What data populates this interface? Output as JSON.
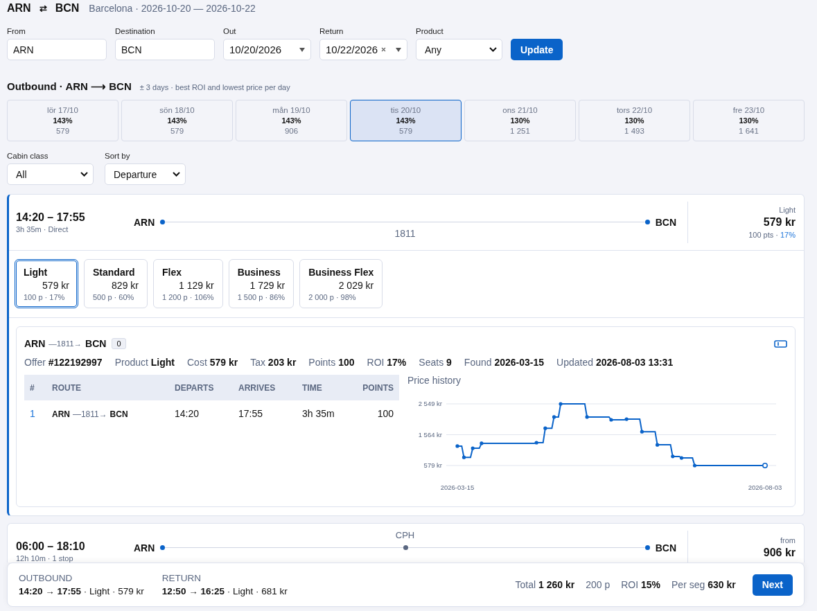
{
  "header": {
    "origin": "ARN",
    "swap": "⇄",
    "destination": "BCN",
    "subtitle": "Barcelona · 2026-10-20 — 2026-10-22"
  },
  "search": {
    "fields": [
      {
        "label": "From",
        "kind": "text",
        "value": "ARN"
      },
      {
        "label": "Destination",
        "kind": "text",
        "value": "BCN"
      },
      {
        "label": "Out",
        "kind": "date",
        "value": "10/20/2026"
      },
      {
        "label": "Return",
        "kind": "date",
        "value": "10/22/2026",
        "clearable": true
      },
      {
        "label": "Product",
        "kind": "select",
        "value": "Any"
      }
    ],
    "button": "Update"
  },
  "outbound": {
    "title": "Outbound · ARN ⟶ BCN",
    "note": "± 3 days · best ROI and lowest price per day",
    "days": [
      {
        "label": "lör 17/10",
        "roi": "143%",
        "price": "579",
        "selected": false
      },
      {
        "label": "sön 18/10",
        "roi": "143%",
        "price": "579",
        "selected": false
      },
      {
        "label": "mån 19/10",
        "roi": "143%",
        "price": "906",
        "selected": false
      },
      {
        "label": "tis 20/10",
        "roi": "143%",
        "price": "579",
        "selected": true
      },
      {
        "label": "ons 21/10",
        "roi": "130%",
        "price": "1 251",
        "selected": false
      },
      {
        "label": "tors 22/10",
        "roi": "130%",
        "price": "1 493",
        "selected": false
      },
      {
        "label": "fre 23/10",
        "roi": "130%",
        "price": "1 641",
        "selected": false
      }
    ]
  },
  "filters": [
    {
      "label": "Cabin class",
      "value": "All"
    },
    {
      "label": "Sort by",
      "value": "Departure"
    }
  ],
  "flights": [
    {
      "times": "14:20 – 17:55",
      "summary": "3h 35m · Direct",
      "from": "ARN",
      "to": "BCN",
      "segments": [
        "1811"
      ],
      "fare_label": "Light",
      "price": "579 kr",
      "points": "100 pts ·",
      "roi": "17%",
      "expanded": true,
      "fares": [
        {
          "name": "Light",
          "price": "579 kr",
          "meta": "100 p · 17%",
          "selected": true
        },
        {
          "name": "Standard",
          "price": "829 kr",
          "meta": "500 p · 60%",
          "selected": false
        },
        {
          "name": "Flex",
          "price": "1 129 kr",
          "meta": "1 200 p · 106%",
          "selected": false
        },
        {
          "name": "Business",
          "price": "1 729 kr",
          "meta": "1 500 p · 86%",
          "selected": false
        },
        {
          "name": "Business Flex",
          "price": "2 029 kr",
          "meta": "2 000 p · 98%",
          "selected": false
        }
      ],
      "detail": {
        "from": "ARN",
        "flight": "—1811→",
        "to": "BCN",
        "badge": "0",
        "meta": [
          {
            "label": "Offer",
            "value": "#122192997"
          },
          {
            "label": "Product",
            "value": "Light"
          },
          {
            "label": "Cost",
            "value": "579 kr"
          },
          {
            "label": "Tax",
            "value": "203 kr"
          },
          {
            "label": "Points",
            "value": "100"
          },
          {
            "label": "ROI",
            "value": "17%"
          },
          {
            "label": "Seats",
            "value": "9"
          },
          {
            "label": "Found",
            "value": "2026-03-15"
          },
          {
            "label": "Updated",
            "value": "2026-08-03 13:31"
          }
        ],
        "table": {
          "columns": [
            "#",
            "ROUTE",
            "DEPARTS",
            "ARRIVES",
            "TIME",
            "POINTS"
          ],
          "rows": [
            {
              "index": "1",
              "from": "ARN",
              "flight": "—1811→",
              "to": "BCN",
              "departs": "14:20",
              "arrives": "17:55",
              "time": "3h 35m",
              "points": "100"
            }
          ]
        },
        "price_history": {
          "title": "Price history",
          "chart_data": {
            "type": "line",
            "categories": [
              "2026-03-15",
              null,
              null,
              null,
              null,
              null,
              null,
              null,
              null,
              null,
              null,
              null,
              null,
              null,
              null,
              null,
              null,
              null,
              null,
              null,
              null,
              null,
              null,
              null,
              null,
              null,
              null,
              null,
              null,
              null,
              null,
              null,
              null,
              null,
              null,
              null,
              null,
              null,
              null,
              null,
              null,
              null,
              null,
              null,
              null,
              null,
              null,
              null,
              null,
              null,
              null,
              null,
              null,
              null,
              null,
              null,
              null,
              null,
              null,
              null,
              null,
              null,
              null,
              null,
              null,
              null,
              null,
              null,
              null,
              null,
              null,
              null,
              null,
              null,
              null,
              null,
              null,
              null,
              null,
              null,
              null,
              null,
              null,
              null,
              null,
              null,
              null,
              null,
              null,
              null,
              null,
              null,
              null,
              null,
              null,
              null,
              null,
              null,
              null,
              null,
              null,
              null,
              null,
              null,
              null,
              null,
              null,
              null,
              null,
              null,
              null,
              null,
              null,
              null,
              null,
              null,
              null,
              null,
              null,
              null,
              null,
              null,
              null,
              null,
              null,
              null,
              null,
              null,
              null,
              null,
              null,
              null,
              null,
              null,
              null,
              null,
              null,
              null,
              null,
              null,
              "2026-08-03"
            ],
            "series": [
              {
                "color": "#0a63c9",
                "values": [
                  1200,
                  1200,
                  1200,
                  840,
                  840,
                  840,
                  840,
                  1130,
                  1130,
                  1130,
                  1130,
                  1290,
                  1290,
                  1290,
                  1290,
                  1290,
                  1290,
                  1290,
                  1290,
                  1290,
                  1290,
                  1290,
                  1290,
                  1290,
                  1290,
                  1290,
                  1290,
                  1290,
                  1290,
                  1290,
                  1290,
                  1290,
                  1290,
                  1290,
                  1290,
                  1290,
                  1310,
                  1310,
                  1310,
                  1310,
                  1770,
                  1770,
                  1770,
                  1770,
                  2130,
                  2130,
                  2130,
                  2549,
                  2549,
                  2549,
                  2549,
                  2549,
                  2549,
                  2549,
                  2549,
                  2549,
                  2549,
                  2549,
                  2549,
                  2130,
                  2130,
                  2130,
                  2130,
                  2130,
                  2130,
                  2130,
                  2130,
                  2130,
                  2130,
                  2130,
                  2040,
                  2040,
                  2040,
                  2040,
                  2040,
                  2040,
                  2040,
                  2060,
                  2060,
                  2060,
                  2060,
                  2060,
                  2060,
                  2060,
                  1660,
                  1660,
                  1660,
                  1660,
                  1660,
                  1660,
                  1660,
                  1240,
                  1240,
                  1240,
                  1240,
                  1240,
                  1240,
                  1240,
                  870,
                  870,
                  870,
                  870,
                  820,
                  820,
                  820,
                  820,
                  820,
                  820,
                  579,
                  579,
                  579,
                  579,
                  579,
                  579,
                  579,
                  579,
                  579,
                  579,
                  579,
                  579,
                  579,
                  579,
                  579,
                  579,
                  579,
                  579,
                  579,
                  579,
                  579,
                  579,
                  579,
                  579,
                  579,
                  579,
                  579,
                  579,
                  579,
                  579,
                  579,
                  579,
                  579
                ]
              }
            ],
            "ylim": [
              579,
              2549
            ],
            "yticks": [
              {
                "value": 579,
                "label": "579 kr"
              },
              {
                "value": 1564,
                "label": "1 564 kr"
              },
              {
                "value": 2549,
                "label": "2 549 kr"
              }
            ]
          }
        }
      }
    },
    {
      "times": "06:00 – 18:10",
      "summary": "12h 10m · 1 stop",
      "from": "ARN",
      "to": "BCN",
      "stops": [
        "CPH"
      ],
      "fare_label": "from",
      "price": "906 kr",
      "expanded": false
    }
  ],
  "footer": {
    "legs": [
      {
        "label": "OUTBOUND",
        "value": "**14:20 → 17:55** · Light · 579 kr"
      },
      {
        "label": "RETURN",
        "value": "**12:50 → 16:25** · Light · 681 kr"
      }
    ],
    "totals": [
      "Total **1 260 kr**",
      "200 p",
      "ROI **15%**",
      "Per seg **630 kr**"
    ],
    "button": "Next"
  }
}
